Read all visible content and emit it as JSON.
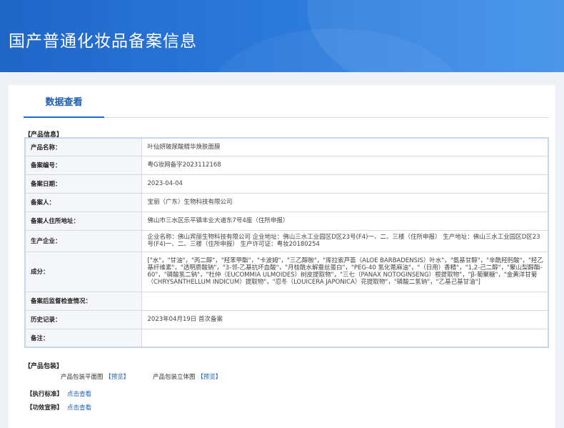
{
  "header": {
    "title": "国产普通化妆品备案信息"
  },
  "tabs": [
    {
      "label": "数据查看"
    }
  ],
  "product_info": {
    "section_label": "【产品信息】",
    "rows": [
      {
        "key": "产品名称：",
        "value": "叶仙妍玻尿酸精华焕肤面膜"
      },
      {
        "key": "备案编号：",
        "value": "粤G妆网备字2023112168"
      },
      {
        "key": "备案日期：",
        "value": "2023-04-04"
      },
      {
        "key": "备案人：",
        "value": "宝丽（广东）生物科技有限公司"
      },
      {
        "key": "备案人住所地址：",
        "value": "佛山市三水区乐平镇丰业大道东7号4座（住所申报）"
      },
      {
        "key": "生产企业：",
        "value": "企业名称：佛山宾丽生物科技有限公司 企业地址：佛山三水工业园区D区23号(F4)一、二、三楼（住所申报） 生产地址：佛山三水工业园区D区23号(F4)一、二、三楼（住所申报） 生产许可证：粤妆20180254"
      },
      {
        "key": "成分：",
        "value": "[\"水\"，\"甘油\"，\"丙二醇\"，\"羟苯甲酯\"，\"卡波姆\"，\"三乙醇胺\"，\"库拉索芦荟（ALOE BARBADENSIS）叶水\"，\"氨基甘醇\"，\"辛酰羟肟酸\"，\"羟乙基纤维素\"，\"透明质酸钠\"，\"3-邻-乙基抗坏血酸\"，\"月桂酰水解蚕丝蛋白\"，\"PEG-40 氢化蓖麻油\"，\"（日用）香精\"，\"1,2-己二醇\"，\"聚山梨醇酯-60\"，\"磷酸氢二钠\"，\"杜仲（EUCOMMIA ULMOIDES）树皮提取物\"，\"三七（PANAX NOTOGINSENG）根提取物\"，\"β-葡聚糖\"，\"金黄洋甘菊（CHRYSANTHELLUM INDICUM）提取物\"，\"忍冬（LOUICERA JAPONICA）花提取物\"，\"磷酸二氢钠\"，\"乙基己基甘油\"]"
      },
      {
        "key": "备案后监督检查情况：",
        "value": ""
      },
      {
        "key": "历史记录：",
        "value": "2023年04月19日 首次备案"
      },
      {
        "key": "备注：",
        "value": ""
      }
    ]
  },
  "packaging": {
    "section_label": "【产品包装】",
    "items": [
      {
        "label": "产品包装平面图",
        "link": "【预览】"
      },
      {
        "label": "产品包装立体图",
        "link": "【预览】"
      }
    ]
  },
  "standard": {
    "label": "【执行标准】",
    "link": "点击查看"
  },
  "efficacy": {
    "label": "【功效宣称】",
    "link": "点击查看"
  }
}
